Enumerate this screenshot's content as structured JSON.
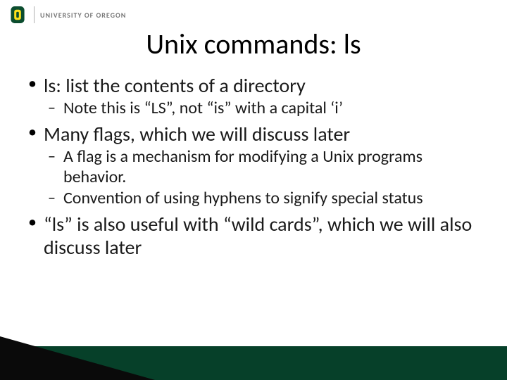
{
  "header": {
    "university": "UNIVERSITY OF OREGON"
  },
  "title": "Unix commands: ls",
  "bullets": [
    {
      "text": "ls: list the contents of a directory",
      "sub": [
        "Note this is “LS”, not “is” with a capital ‘i’"
      ]
    },
    {
      "text": "Many flags, which we will discuss later",
      "sub": [
        "A flag is a mechanism for modifying a Unix programs behavior.",
        "Convention of using hyphens to signify special status"
      ]
    },
    {
      "text": "“ls” is also useful with “wild cards”, which we will also discuss later",
      "sub": []
    }
  ],
  "colors": {
    "brand_green": "#064029",
    "brand_yellow": "#FEE11A"
  }
}
